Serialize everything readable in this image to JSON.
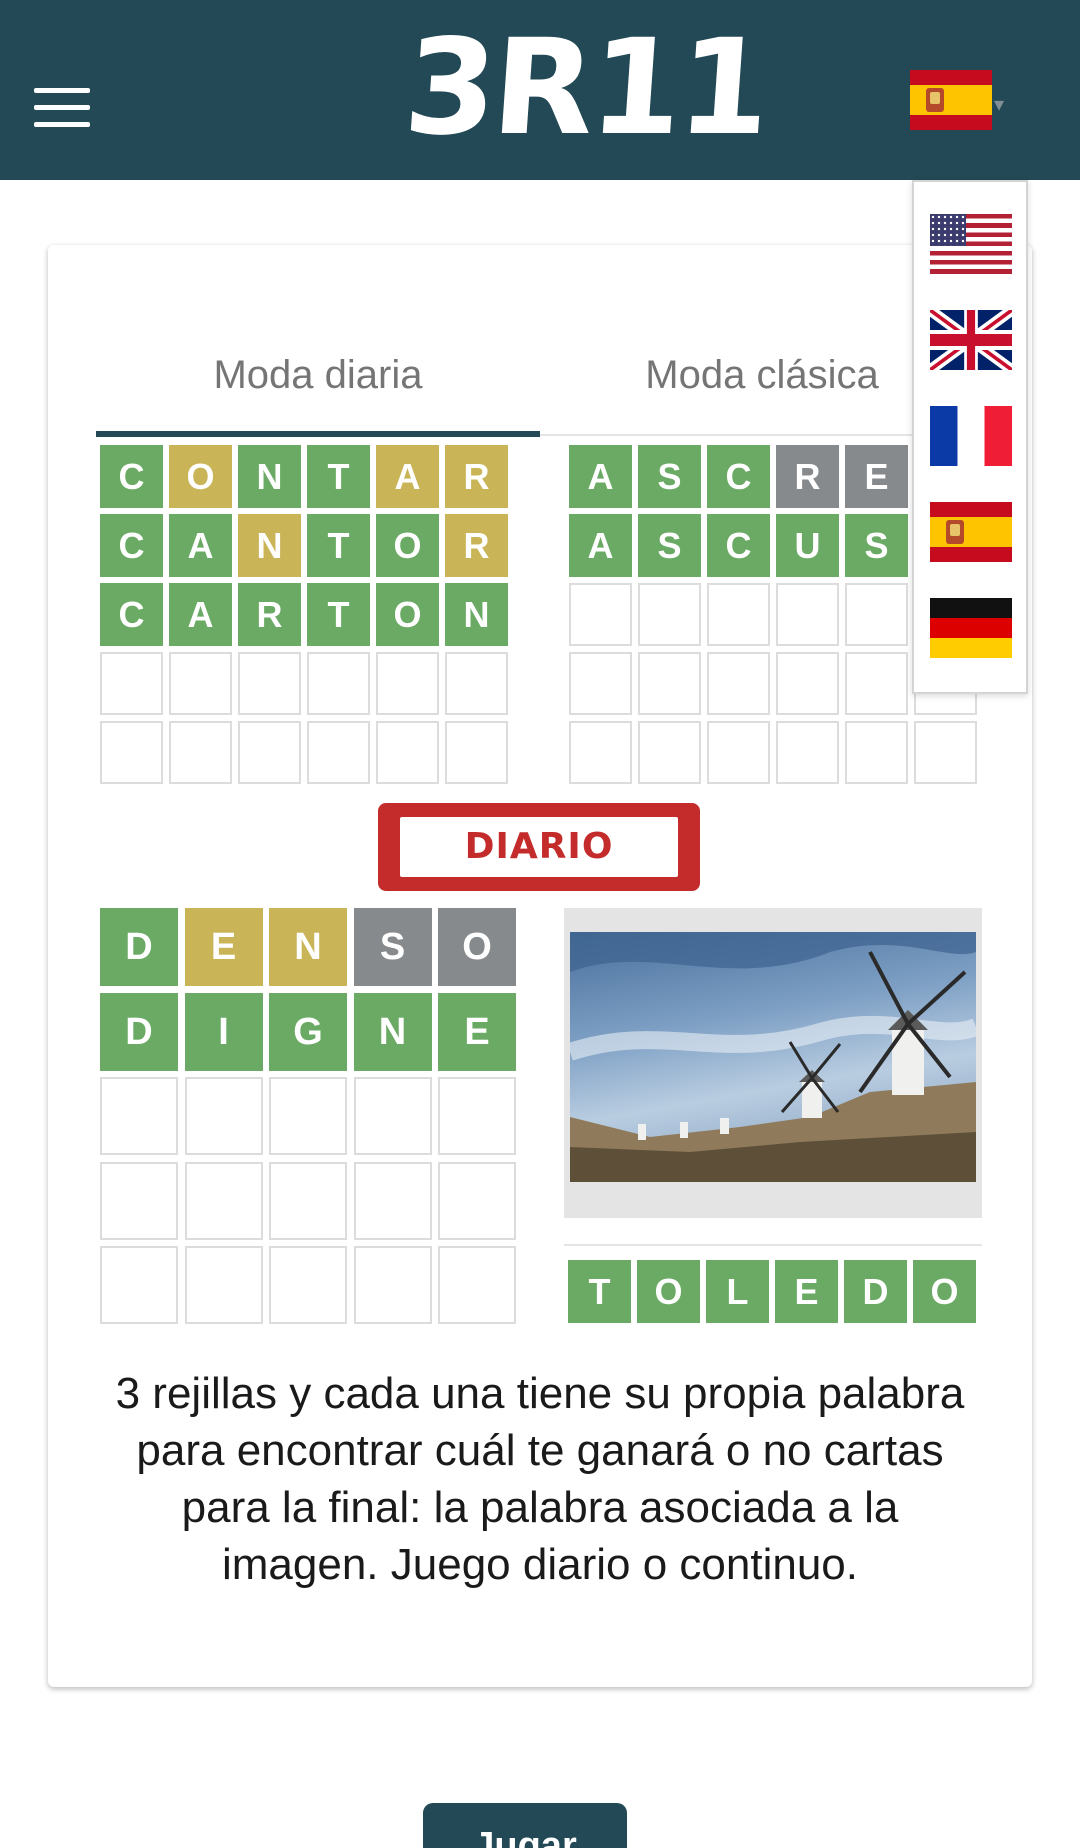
{
  "header": {
    "logo_text": "3R11",
    "current_language": "es",
    "menu_icon": "hamburger-menu-icon",
    "dropdown_icon": "caret-down-icon",
    "color": "#224955"
  },
  "language_menu": {
    "options": [
      {
        "code": "en-us",
        "icon": "flag-us-icon"
      },
      {
        "code": "en-gb",
        "icon": "flag-uk-icon"
      },
      {
        "code": "fr",
        "icon": "flag-fr-icon"
      },
      {
        "code": "es",
        "icon": "flag-es-icon"
      },
      {
        "code": "de",
        "icon": "flag-de-icon"
      }
    ]
  },
  "card": {
    "tabs": [
      {
        "label": "Moda diaria",
        "active": true
      },
      {
        "label": "Moda clásica",
        "active": false
      }
    ],
    "grid_top_left": {
      "rows": [
        [
          [
            "C",
            "g"
          ],
          [
            "O",
            "y"
          ],
          [
            "N",
            "g"
          ],
          [
            "T",
            "g"
          ],
          [
            "A",
            "y"
          ],
          [
            "R",
            "y"
          ]
        ],
        [
          [
            "C",
            "g"
          ],
          [
            "A",
            "g"
          ],
          [
            "N",
            "y"
          ],
          [
            "T",
            "g"
          ],
          [
            "O",
            "g"
          ],
          [
            "R",
            "y"
          ]
        ],
        [
          [
            "C",
            "g"
          ],
          [
            "A",
            "g"
          ],
          [
            "R",
            "g"
          ],
          [
            "T",
            "g"
          ],
          [
            "O",
            "g"
          ],
          [
            "N",
            "g"
          ]
        ],
        [
          [
            "",
            ""
          ],
          [
            "",
            ""
          ],
          [
            "",
            ""
          ],
          [
            "",
            ""
          ],
          [
            "",
            ""
          ],
          [
            "",
            ""
          ]
        ],
        [
          [
            "",
            ""
          ],
          [
            "",
            ""
          ],
          [
            "",
            ""
          ],
          [
            "",
            ""
          ],
          [
            "",
            ""
          ],
          [
            "",
            ""
          ]
        ]
      ]
    },
    "grid_top_right": {
      "rows": [
        [
          [
            "A",
            "g"
          ],
          [
            "S",
            "g"
          ],
          [
            "C",
            "g"
          ],
          [
            "R",
            "x"
          ],
          [
            "E",
            "x"
          ],
          [
            "",
            ""
          ]
        ],
        [
          [
            "A",
            "g"
          ],
          [
            "S",
            "g"
          ],
          [
            "C",
            "g"
          ],
          [
            "U",
            "g"
          ],
          [
            "S",
            "g"
          ],
          [
            "",
            ""
          ]
        ],
        [
          [
            "",
            ""
          ],
          [
            "",
            ""
          ],
          [
            "",
            ""
          ],
          [
            "",
            ""
          ],
          [
            "",
            ""
          ],
          [
            "",
            ""
          ]
        ],
        [
          [
            "",
            ""
          ],
          [
            "",
            ""
          ],
          [
            "",
            ""
          ],
          [
            "",
            ""
          ],
          [
            "",
            ""
          ],
          [
            "",
            ""
          ]
        ],
        [
          [
            "",
            ""
          ],
          [
            "",
            ""
          ],
          [
            "",
            ""
          ],
          [
            "",
            ""
          ],
          [
            "",
            ""
          ],
          [
            "",
            ""
          ]
        ]
      ]
    },
    "stamp_label": "DIARIO",
    "grid_bottom_left": {
      "rows": [
        [
          [
            "D",
            "g"
          ],
          [
            "E",
            "y"
          ],
          [
            "N",
            "y"
          ],
          [
            "S",
            "x"
          ],
          [
            "O",
            "x"
          ]
        ],
        [
          [
            "D",
            "g"
          ],
          [
            "I",
            "g"
          ],
          [
            "G",
            "g"
          ],
          [
            "N",
            "g"
          ],
          [
            "E",
            "g"
          ]
        ],
        [
          [
            "",
            ""
          ],
          [
            "",
            ""
          ],
          [
            "",
            ""
          ],
          [
            "",
            ""
          ],
          [
            "",
            ""
          ]
        ],
        [
          [
            "",
            ""
          ],
          [
            "",
            ""
          ],
          [
            "",
            ""
          ],
          [
            "",
            ""
          ],
          [
            "",
            ""
          ]
        ],
        [
          [
            "",
            ""
          ],
          [
            "",
            ""
          ],
          [
            "",
            ""
          ],
          [
            "",
            ""
          ],
          [
            "",
            ""
          ]
        ]
      ]
    },
    "image_answer": {
      "rows": [
        [
          [
            "T",
            "g"
          ],
          [
            "O",
            "g"
          ],
          [
            "L",
            "g"
          ],
          [
            "E",
            "g"
          ],
          [
            "D",
            "g"
          ],
          [
            "O",
            "g"
          ]
        ]
      ]
    },
    "description": "3 rejillas y cada una tiene su propia palabra para encontrar cuál te ganará o no cartas para la final: la palabra asociada a la imagen. Juego diario o continuo."
  },
  "play_button": {
    "label": "Jugar"
  },
  "colors": {
    "green": "#6aaa64",
    "yellow": "#c9b458",
    "gray": "#878a8c",
    "stamp_red": "#c42b2b"
  }
}
